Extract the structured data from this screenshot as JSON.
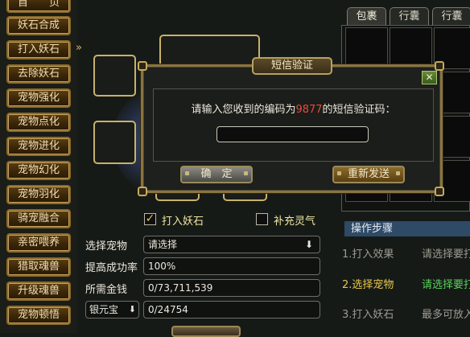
{
  "sidebar": {
    "items": [
      "首　　页",
      "妖石合成",
      "打入妖石",
      "去除妖石",
      "宠物强化",
      "宠物点化",
      "宠物进化",
      "宠物幻化",
      "宠物羽化",
      "骑宠融合",
      "亲密喂养",
      "猎取魂兽",
      "升级魂兽",
      "宠物顿悟"
    ],
    "arrow": "»"
  },
  "inventory": {
    "tabs": [
      "包裹",
      "行囊",
      "行囊"
    ],
    "active_tab": 0
  },
  "dialog": {
    "title": "短信验证",
    "message_before": "请输入您收到的编码为",
    "code": "9877",
    "message_after": "的短信验证码：",
    "input_value": "",
    "close_label": "✕",
    "confirm_label": "确　定",
    "resend_label": "重新发送"
  },
  "form": {
    "check_insert": {
      "label": "打入妖石",
      "checked": true
    },
    "check_refill": {
      "label": "补充灵气",
      "checked": false
    },
    "select_pet_label": "选择宠物",
    "select_pet_value": "请选择",
    "success_rate_label": "提高成功率",
    "success_rate_value": "100%",
    "money_label": "所需金钱",
    "money_value": "0/73,711,539",
    "currency_select": "银元宝",
    "currency_value": "0/24754",
    "bottom_button_label": ""
  },
  "steps": {
    "header": "操作步骤",
    "items": [
      {
        "num": "1.打入效果",
        "desc": "请选择要打"
      },
      {
        "num": "2.选择宠物",
        "desc": "请选择要打"
      },
      {
        "num": "3.打入妖石",
        "desc": "最多可放入"
      }
    ],
    "active_index": 1
  },
  "colors": {
    "accent_gold": "#c9a25a",
    "active_step": "#e8c84a",
    "active_desc": "#5ad05a",
    "code_red": "#e84a3a"
  }
}
